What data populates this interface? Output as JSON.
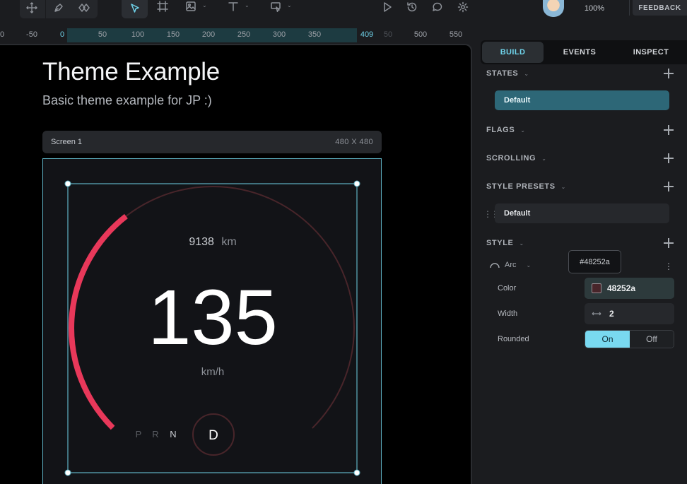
{
  "toolbar": {
    "zoom": "100%",
    "feedback_label": "FEEDBACK"
  },
  "ruler": {
    "ticks": [
      {
        "label": "0",
        "highlight": false
      },
      {
        "label": "-50",
        "highlight": false
      },
      {
        "label": "0",
        "highlight": true
      },
      {
        "label": "50",
        "highlight": false
      },
      {
        "label": "100",
        "highlight": false
      },
      {
        "label": "150",
        "highlight": false
      },
      {
        "label": "200",
        "highlight": false
      },
      {
        "label": "250",
        "highlight": false
      },
      {
        "label": "300",
        "highlight": false
      },
      {
        "label": "350",
        "highlight": false
      },
      {
        "label": "409",
        "highlight": true
      },
      {
        "label": "50",
        "highlight": false
      },
      {
        "label": "500",
        "highlight": false
      },
      {
        "label": "550",
        "highlight": false
      }
    ]
  },
  "canvas": {
    "title": "Theme Example",
    "subtitle": "Basic theme example for JP :)",
    "screen_name": "Screen 1",
    "screen_dims": "480 X 480"
  },
  "gauge": {
    "odometer_value": "9138",
    "odometer_unit": "km",
    "speed": "135",
    "speed_unit": "km/h",
    "gears": [
      "P",
      "R",
      "N"
    ],
    "active_gear": "D",
    "accent_color": "#e8385a",
    "track_color": "#48252a",
    "fill_fraction": 0.36
  },
  "panel": {
    "tabs": [
      "BUILD",
      "EVENTS",
      "INSPECT"
    ],
    "active_tab": "BUILD",
    "states_label": "STATES",
    "state_default": "Default",
    "flags_label": "FLAGS",
    "scrolling_label": "SCROLLING",
    "style_presets_label": "STYLE PRESETS",
    "preset_default": "Default",
    "style_label": "STYLE",
    "arc_label": "Arc",
    "tooltip": "#48252a",
    "color_label": "Color",
    "color_value": "48252a",
    "width_label": "Width",
    "width_value": "2",
    "rounded_label": "Rounded",
    "rounded_on": "On",
    "rounded_off": "Off"
  }
}
